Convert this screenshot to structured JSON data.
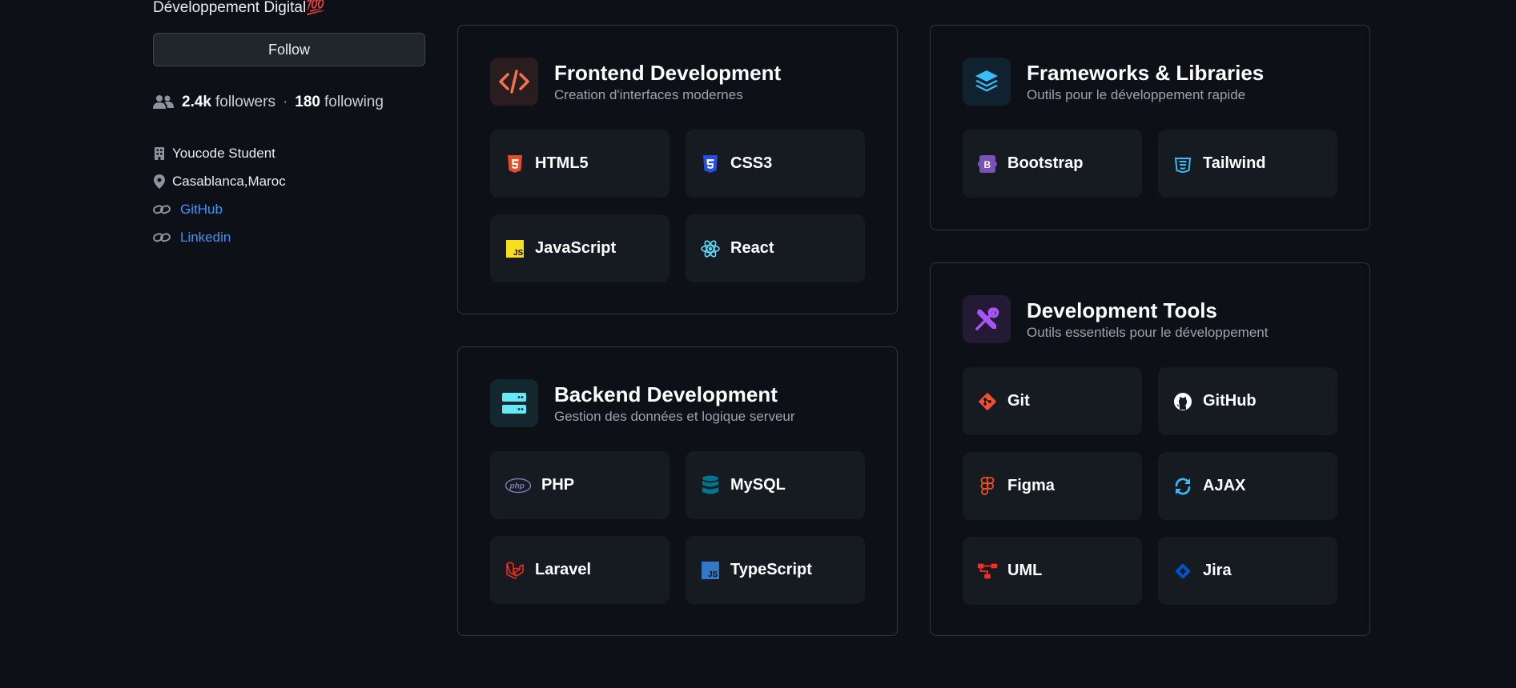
{
  "profile": {
    "bio": "Développement Digital💯",
    "follow_label": "Follow",
    "followers_count": "2.4k",
    "followers_label": "followers",
    "separator": "·",
    "following_count": "180",
    "following_label": "following",
    "organization": "Youcode Student",
    "location": "Casablanca,Maroc",
    "links": [
      "GitHub",
      "Linkedin"
    ]
  },
  "cards": {
    "frontend": {
      "title": "Frontend Development",
      "subtitle": "Creation d'interfaces modernes",
      "items": [
        "HTML5",
        "CSS3",
        "JavaScript",
        "React"
      ],
      "accent": "#f0734e"
    },
    "frameworks": {
      "title": "Frameworks & Libraries",
      "subtitle": "Outils pour le développement rapide",
      "items": [
        "Bootstrap",
        "Tailwind"
      ],
      "accent": "#38bdf8"
    },
    "backend": {
      "title": "Backend Development",
      "subtitle": "Gestion des données et logique serveur",
      "items": [
        "PHP",
        "MySQL",
        "Laravel",
        "TypeScript"
      ],
      "accent": "#67e8f9"
    },
    "tools": {
      "title": "Development Tools",
      "subtitle": "Outils essentiels pour le développement",
      "items": [
        "Git",
        "GitHub",
        "Figma",
        "AJAX",
        "UML",
        "Jira"
      ],
      "accent": "#a855f7"
    }
  },
  "icons": {
    "frontend": "code-icon",
    "frameworks": "layers-icon",
    "backend": "server-icon",
    "tools": "tools-icon",
    "html5": "html5-icon",
    "css3": "css3-icon",
    "javascript": "javascript-icon",
    "react": "react-icon",
    "bootstrap": "bootstrap-icon",
    "tailwind": "tailwind-icon",
    "php": "php-icon",
    "mysql": "database-icon",
    "laravel": "laravel-icon",
    "typescript": "typescript-icon",
    "git": "git-icon",
    "github": "github-icon",
    "figma": "figma-icon",
    "ajax": "refresh-icon",
    "uml": "diagram-icon",
    "jira": "jira-icon"
  }
}
